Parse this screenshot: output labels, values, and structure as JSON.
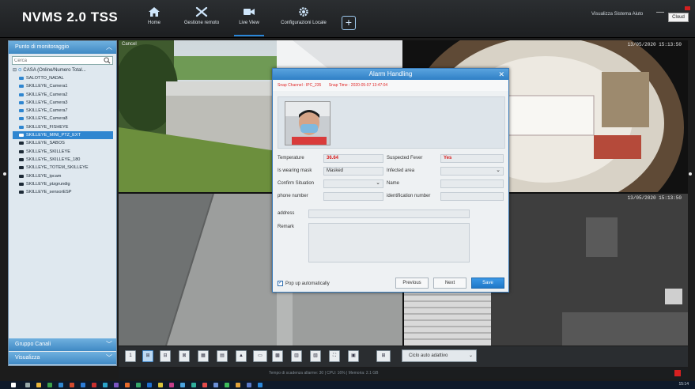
{
  "header": {
    "app_title": "NVMS 2.0 TSS",
    "nav": [
      {
        "label": "Home",
        "icon": "home-icon"
      },
      {
        "label": "Gestione remoto",
        "icon": "tools-icon"
      },
      {
        "label": "Live View",
        "icon": "video-camera-icon"
      },
      {
        "label": "Configurazioni Locale",
        "icon": "gear-icon"
      }
    ],
    "active_nav": "Live View",
    "user": "Visualizza Sistema Aiuto",
    "cloud": "Cloud"
  },
  "sidebar": {
    "title": "Punto di monitoraggio",
    "search_placeholder": "Cerca",
    "root": "CASA (Online/Numero Total...",
    "items": [
      "SALOTTO_NADAL",
      "SKILLEYE_Camera1",
      "SKILLEYE_Camera2",
      "SKILLEYE_Camera3",
      "SKILLEYE_Camera7",
      "SKILLEYE_Camera8",
      "SKILLEYE_FISHEYE",
      "SKILLEYE_MINI_PTZ_EXT",
      "SKILLEYE_SABOS",
      "SKILLEYE_SKILLEYE",
      "SKILLEYE_SKILLEYE_180",
      "SKILLEYE_TOTEM_SKILLEYE",
      "SKILLEYE_ipcam",
      "SKILLEYE_ptzgrundig",
      "SKILLEYE_sensorESP"
    ],
    "selected_index": 7,
    "group_label": "Gruppo Canali",
    "view_label": "Visualizza"
  },
  "video": {
    "tile1_name": "Cancel",
    "tile2_timestamp": "13/05/2020 15:13:50",
    "tile4_timestamp": "13/05/2020 15:13:50"
  },
  "dialog": {
    "title": "Alarm Handling",
    "snap_channel": "Snap Channel : IPC_235",
    "snap_time": "Snap Time : 2020-05-07 13:47:04",
    "temperature_label": "Temperature",
    "temperature_value": "36.64",
    "suspected_fever_label": "Suspected Fever",
    "suspected_fever_value": "Yes",
    "mask_label": "Is wearing mask",
    "mask_value": "Masked",
    "infected_label": "Infected area",
    "confirm_label": "Confirm Situation",
    "name_label": "Name",
    "phone_label": "phone number",
    "id_label": "identification number",
    "address_label": "address",
    "remark_label": "Remark",
    "popup_label": "Pop up automatically",
    "previous_label": "Previous",
    "next_label": "Next",
    "save_label": "Save"
  },
  "toolbar": {
    "layout_select": "Ciclo auto adattivo",
    "single_label": "1"
  },
  "status": {
    "text": "Tempo di scadenza allarme: 30  |  CPU: 16%  |  Memoria: 2.1 GB"
  },
  "taskbar": {
    "clock": "15:14"
  },
  "colors": {
    "accent": "#2f86d0",
    "alarm_red": "#d81e1e",
    "header_bg": "#2b2e31"
  }
}
